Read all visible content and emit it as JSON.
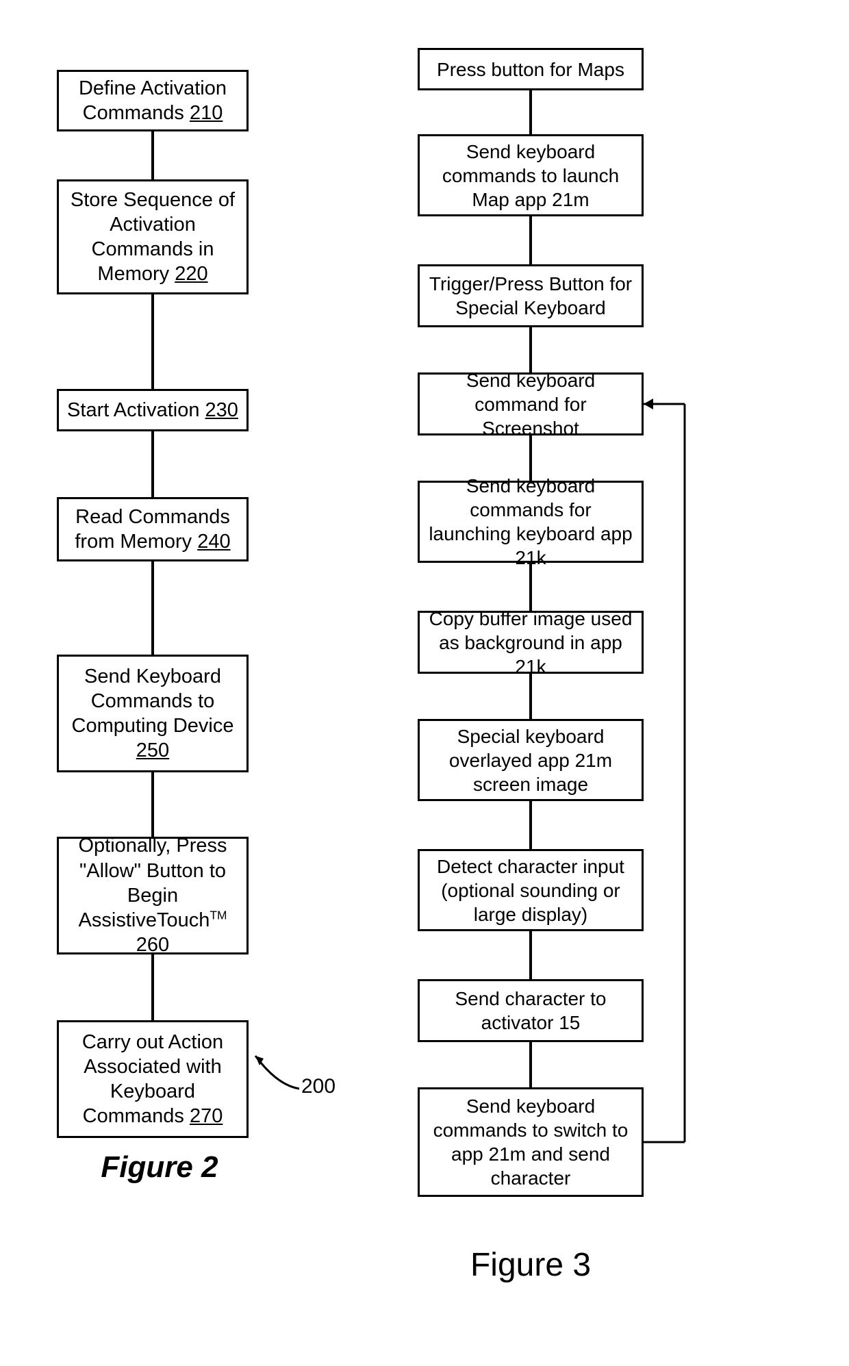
{
  "fig2": {
    "caption": "Figure 2",
    "callout": "200",
    "steps": [
      {
        "text": "Define Activation Commands ",
        "ref": "210"
      },
      {
        "text": "Store Sequence of Activation Commands in Memory ",
        "ref": "220"
      },
      {
        "text": "Start Activation ",
        "ref": "230"
      },
      {
        "text": "Read Commands from Memory ",
        "ref": "240"
      },
      {
        "text": "Send Keyboard Commands to Computing Device ",
        "ref": "250"
      },
      {
        "text_pre": "Optionally, Press \"Allow\" Button to Begin AssistiveTouch",
        "tm": "TM",
        "ref": "260"
      },
      {
        "text": "Carry out Action Associated with Keyboard Commands ",
        "ref": "270"
      }
    ]
  },
  "fig3": {
    "caption": "Figure 3",
    "steps": [
      {
        "text": "Press button for Maps"
      },
      {
        "text": "Send keyboard commands to launch Map app 21m"
      },
      {
        "text": "Trigger/Press Button for Special Keyboard"
      },
      {
        "text": "Send keyboard command for Screenshot"
      },
      {
        "text": "Send keyboard commands for launching keyboard app 21k"
      },
      {
        "text": "Copy buffer image used as background in app 21k"
      },
      {
        "text": "Special keyboard overlayed app 21m screen image"
      },
      {
        "text": "Detect character input (optional sounding or large display)"
      },
      {
        "text": "Send character to activator 15"
      },
      {
        "text": "Send keyboard commands to switch to app 21m and send character"
      }
    ]
  }
}
